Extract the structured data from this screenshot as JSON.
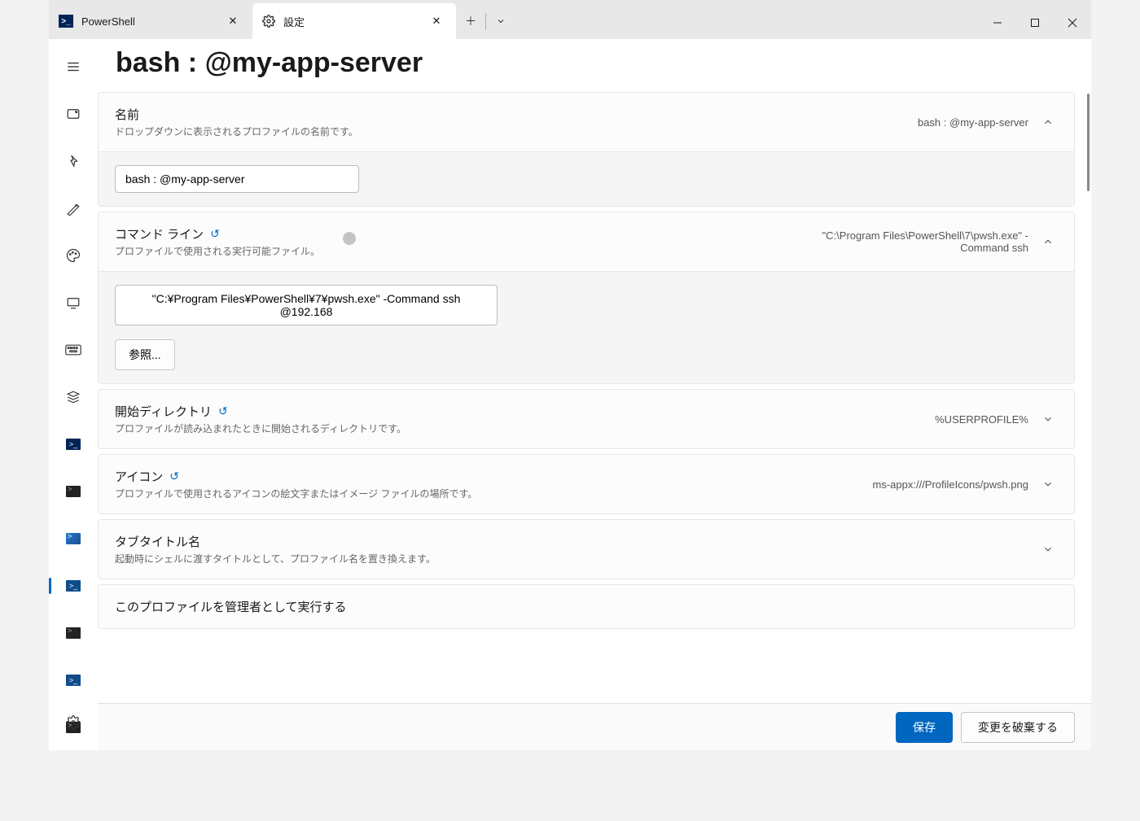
{
  "titlebar": {
    "tabs": [
      {
        "label": "PowerShell"
      },
      {
        "label": "設定"
      }
    ]
  },
  "page": {
    "title": "bash : @my-app-server"
  },
  "settings": {
    "name": {
      "title": "名前",
      "desc": "ドロップダウンに表示されるプロファイルの名前です。",
      "value_summary": "bash : @my-app-server",
      "value": "bash : @my-app-server"
    },
    "cmdline": {
      "title": "コマンド ライン",
      "desc": "プロファイルで使用される実行可能ファイル。",
      "value_summary": "\"C:\\Program Files\\PowerShell\\7\\pwsh.exe\" -Command ssh",
      "value": "\"C:¥Program Files¥PowerShell¥7¥pwsh.exe\" -Command ssh @192.168",
      "browse": "参照..."
    },
    "startdir": {
      "title": "開始ディレクトリ",
      "desc": "プロファイルが読み込まれたときに開始されるディレクトリです。",
      "value_summary": "%USERPROFILE%"
    },
    "icon": {
      "title": "アイコン",
      "desc": "プロファイルで使用されるアイコンの絵文字またはイメージ ファイルの場所です。",
      "value_summary": "ms-appx:///ProfileIcons/pwsh.png"
    },
    "tabtitle": {
      "title": "タブタイトル名",
      "desc": "起動時にシェルに渡すタイトルとして、プロファイル名を置き換えます。"
    },
    "runasadmin": {
      "title": "このプロファイルを管理者として実行する"
    }
  },
  "footer": {
    "save": "保存",
    "discard": "変更を破棄する"
  }
}
